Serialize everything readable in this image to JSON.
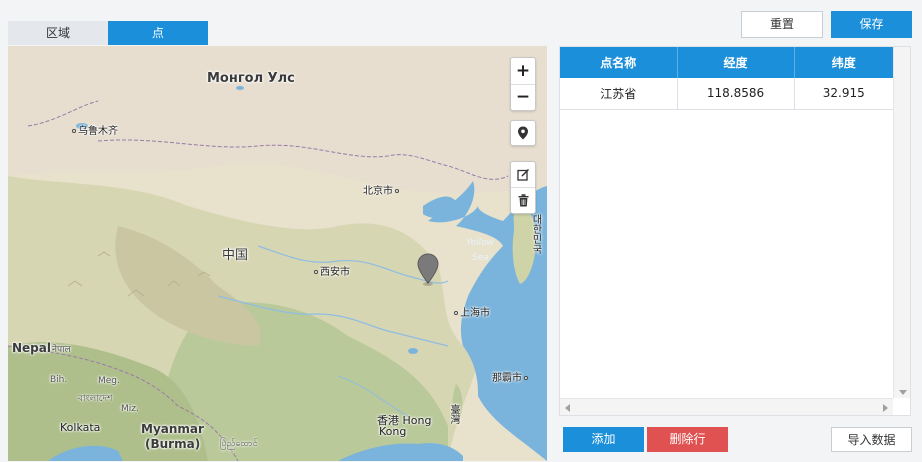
{
  "tabs": [
    {
      "label": "区域",
      "active": false
    },
    {
      "label": "点",
      "active": true
    }
  ],
  "toolbar": {
    "reset_label": "重置",
    "save_label": "保存"
  },
  "map": {
    "labels": {
      "mongolia": "Монгол Улс",
      "urumqi": "乌鲁木齐",
      "beijing": "北京市",
      "china": "中国",
      "xian": "西安市",
      "shanghai": "上海市",
      "naha": "那霸市",
      "hongkong_line1": "香港 Hong",
      "hongkong_line2": "Kong",
      "taiwan": "臺灣",
      "yellow_sea_line1": "Yellow",
      "yellow_sea_line2": "Sea",
      "korea": "대한민국",
      "nepal": "Nepal",
      "myanmar_line1": "Myanmar",
      "myanmar_line2": "(Burma)",
      "kolkata": "Kolkata",
      "bih": "Bih.",
      "meg": "Meg.",
      "miz": "Miz.",
      "bangladesh": "বাংলাদেশ",
      "myanmar_script": "ပြည်ထောင်",
      "nepal_script": "नेपाल"
    },
    "controls": {
      "zoom_in": "+",
      "zoom_out": "−"
    },
    "colors": {
      "water": "#7ab4dc",
      "land": "#e9e2cf",
      "green": "#b9c99a",
      "marker": "#777777"
    }
  },
  "table": {
    "columns": [
      "点名称",
      "经度",
      "纬度"
    ],
    "rows": [
      [
        "江苏省",
        "118.8586",
        "32.915"
      ]
    ]
  },
  "actions": {
    "add_label": "添加",
    "delete_label": "删除行",
    "import_label": "导入数据"
  },
  "colors": {
    "primary": "#1b8fd9",
    "danger": "#e05252"
  }
}
